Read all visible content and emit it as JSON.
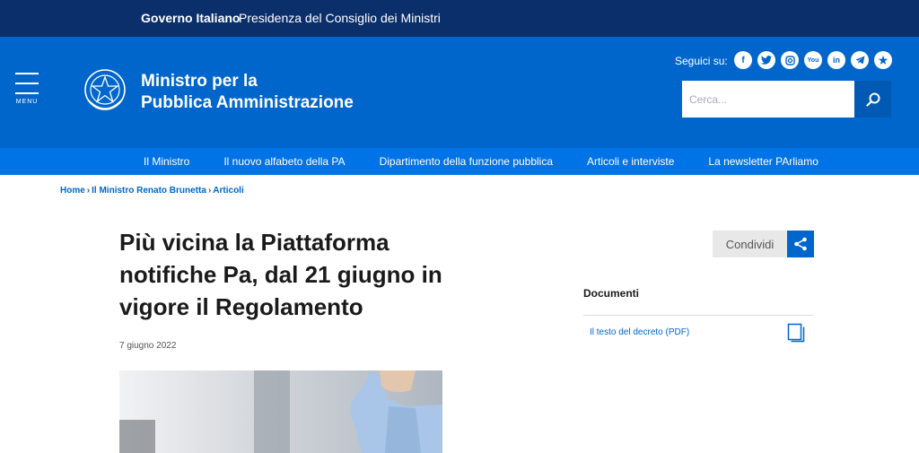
{
  "slimbar": {
    "brand": "Governo Italiano",
    "subtitle": "Presidenza del Consiglio dei Ministri"
  },
  "header": {
    "menu_label": "MENU",
    "title_line1": "Ministro per la",
    "title_line2": "Pubblica Amministrazione",
    "follow_label": "Seguici su:",
    "socials": [
      "facebook-icon",
      "twitter-icon",
      "instagram-icon",
      "youtube-icon",
      "linkedin-icon",
      "telegram-icon",
      "medium-icon"
    ],
    "search_placeholder": "Cerca..."
  },
  "nav": {
    "items": [
      "Il Ministro",
      "Il nuovo alfabeto della PA",
      "Dipartimento della funzione pubblica",
      "Articoli e interviste",
      "La newsletter PArliamo"
    ]
  },
  "breadcrumb": {
    "items": [
      "Home",
      "Il Ministro Renato Brunetta",
      "Articoli"
    ],
    "separator": "›"
  },
  "article": {
    "title": "Più vicina la Piattaforma notifiche Pa, dal 21 giugno in vigore il Regolamento",
    "date": "7 giugno 2022"
  },
  "share": {
    "label": "Condividi"
  },
  "documents": {
    "heading": "Documenti",
    "items": [
      {
        "label": "Il testo del decreto (PDF)"
      }
    ]
  },
  "colors": {
    "top_bar": "#0b2f6b",
    "header": "#0066cc",
    "nav": "#0073e6",
    "link": "#0066cc"
  }
}
